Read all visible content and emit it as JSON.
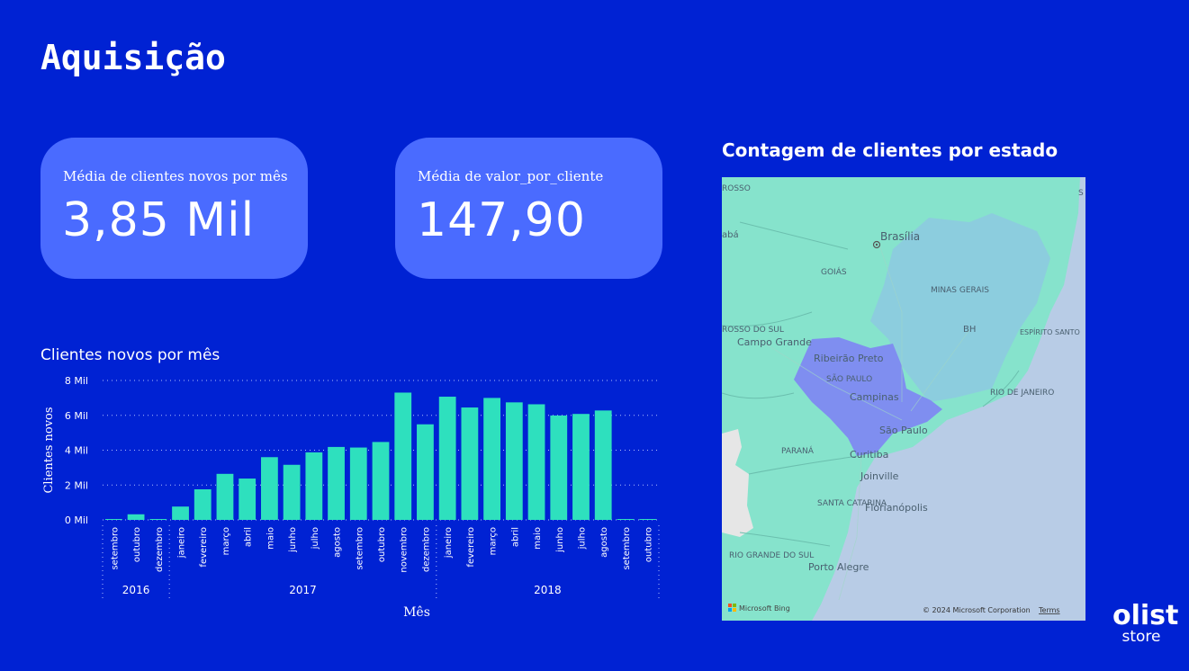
{
  "page": {
    "title": "Aquisição"
  },
  "kpis": [
    {
      "label": "Média de clientes novos por mês",
      "value": "3,85 Mil"
    },
    {
      "label": "Média de valor_por_cliente",
      "value": "147,90"
    }
  ],
  "chart_title": "Clientes novos por mês",
  "chart_data": {
    "type": "bar",
    "title": "",
    "xlabel": "Mês",
    "ylabel": "Clientes novos",
    "ylim": [
      0,
      8000
    ],
    "y_ticks": [
      0,
      2000,
      4000,
      6000,
      8000
    ],
    "y_tick_labels": [
      "0 Mil",
      "2 Mil",
      "4 Mil",
      "6 Mil",
      "8 Mil"
    ],
    "grid": true,
    "bar_color": "#2EE0BE",
    "categories": [
      "setembro",
      "outubro",
      "dezembro",
      "janeiro",
      "fevereiro",
      "março",
      "abril",
      "maio",
      "junho",
      "julho",
      "agosto",
      "setembro",
      "outubro",
      "novembro",
      "dezembro",
      "janeiro",
      "fevereiro",
      "março",
      "abril",
      "maio",
      "junho",
      "julho",
      "agosto",
      "setembro",
      "outubro"
    ],
    "years": [
      {
        "label": "2016",
        "count": 3
      },
      {
        "label": "2017",
        "count": 12
      },
      {
        "label": "2018",
        "count": 10
      }
    ],
    "values": [
      4,
      321,
      1,
      765,
      1755,
      2642,
      2372,
      3600,
      3161,
      3875,
      4185,
      4152,
      4470,
      7304,
      5484,
      7070,
      6450,
      6998,
      6744,
      6634,
      5990,
      6080,
      6278,
      16,
      4
    ]
  },
  "map": {
    "title": "Contagem de clientes por estado",
    "labels": {
      "brasilia": "Brasília",
      "goias": "GOIÁS",
      "minas": "MINAS GERAIS",
      "bh": "BH",
      "es": "ESPÍRITO SANTO",
      "ms": "ROSSO DO SUL",
      "mt": "ROSSO",
      "campo_grande": "Campo Grande",
      "ribeirao": "Ribeirão Preto",
      "sp_state": "SÃO PAULO",
      "campinas": "Campinas",
      "rj": "RIO DE JANEIRO",
      "sao_paulo": "São Paulo",
      "parana": "PARANÁ",
      "curitiba": "Curitiba",
      "joinville": "Joinville",
      "sc": "SANTA CATARINA",
      "floripa": "Florianópolis",
      "rs": "RIO GRANDE DO SUL",
      "porto_alegre": "Porto Alegre",
      "aba": "abá",
      "s": "S"
    },
    "attribution": "Microsoft Bing",
    "copyright": "© 2024 Microsoft Corporation",
    "terms": "Terms",
    "colors": {
      "highlight": "#7F8EF0",
      "region": "#86E3CC",
      "ocean": "#B8CCE6"
    }
  },
  "brand": {
    "name": "olist",
    "sub": "store"
  }
}
